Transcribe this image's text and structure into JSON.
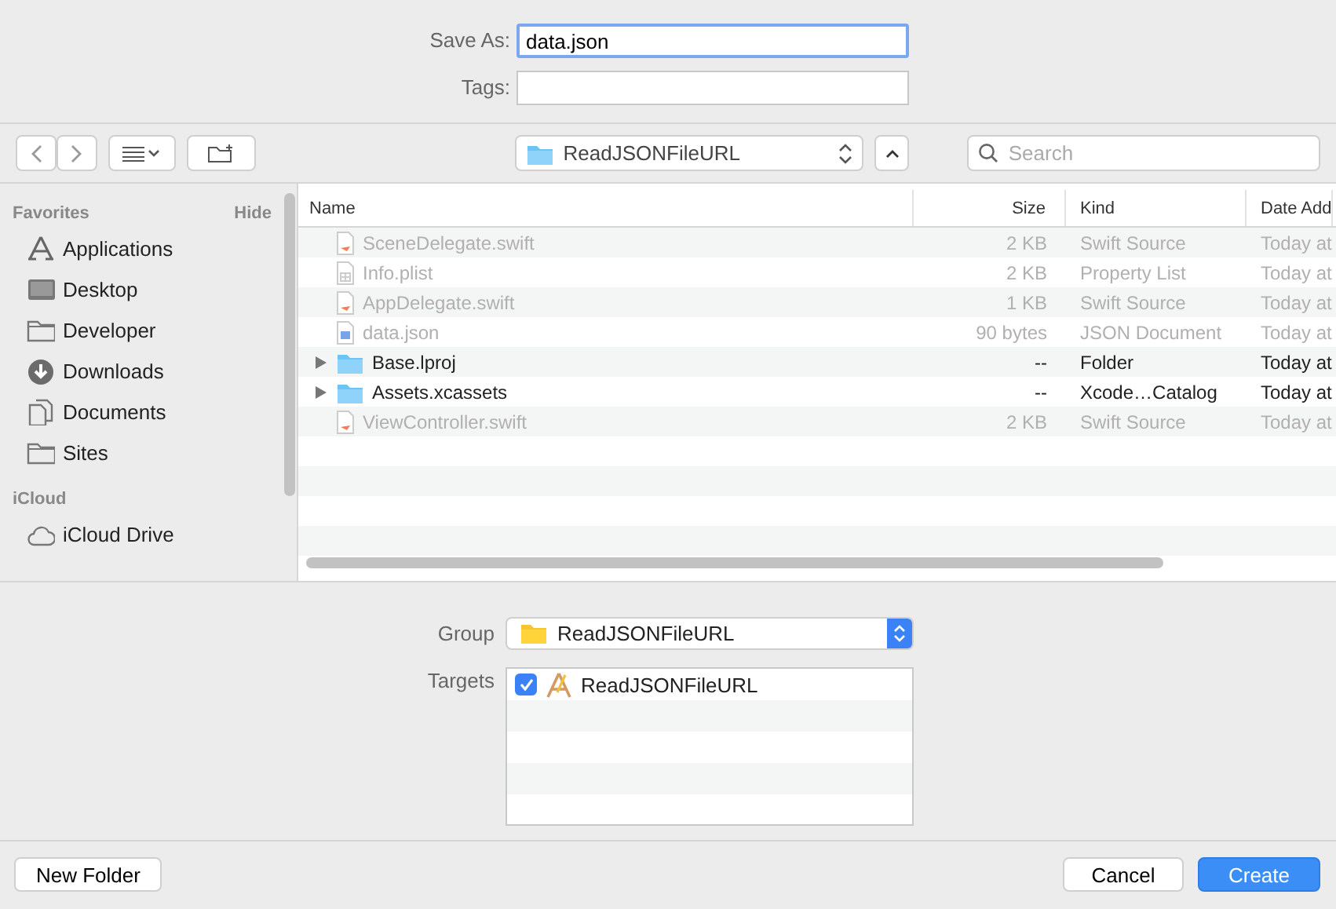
{
  "save_as": {
    "label": "Save As:",
    "value": "data.json"
  },
  "tags": {
    "label": "Tags:"
  },
  "toolbar": {
    "path": "ReadJSONFileURL",
    "search_placeholder": "Search"
  },
  "sidebar": {
    "sections": [
      {
        "title": "Favorites",
        "action": "Hide",
        "items": [
          {
            "label": "Applications"
          },
          {
            "label": "Desktop"
          },
          {
            "label": "Developer"
          },
          {
            "label": "Downloads"
          },
          {
            "label": "Documents"
          },
          {
            "label": "Sites"
          }
        ]
      },
      {
        "title": "iCloud",
        "items": [
          {
            "label": "iCloud Drive"
          }
        ]
      }
    ]
  },
  "table": {
    "columns": [
      "Name",
      "Size",
      "Kind",
      "Date Add"
    ],
    "rows": [
      {
        "kind": "swift",
        "disabled": true,
        "cells": [
          "SceneDelegate.swift",
          "2 KB",
          "Swift Source",
          "Today at"
        ]
      },
      {
        "kind": "plist",
        "disabled": true,
        "cells": [
          "Info.plist",
          "2 KB",
          "Property List",
          "Today at"
        ]
      },
      {
        "kind": "swift",
        "disabled": true,
        "cells": [
          "AppDelegate.swift",
          "1 KB",
          "Swift Source",
          "Today at"
        ]
      },
      {
        "kind": "json",
        "disabled": true,
        "cells": [
          "data.json",
          "90 bytes",
          "JSON Document",
          "Today at"
        ]
      },
      {
        "kind": "folder",
        "disabled": false,
        "cells": [
          "Base.lproj",
          "--",
          "Folder",
          "Today at"
        ]
      },
      {
        "kind": "folder",
        "disabled": false,
        "cells": [
          "Assets.xcassets",
          "--",
          "Xcode…Catalog",
          "Today at"
        ]
      },
      {
        "kind": "swift",
        "disabled": true,
        "cells": [
          "ViewController.swift",
          "2 KB",
          "Swift Source",
          "Today at"
        ]
      }
    ]
  },
  "group": {
    "label": "Group",
    "value": "ReadJSONFileURL"
  },
  "targets": {
    "label": "Targets",
    "items": [
      {
        "label": "ReadJSONFileURL",
        "checked": true
      }
    ]
  },
  "buttons": {
    "new_folder": "New Folder",
    "cancel": "Cancel",
    "create": "Create"
  }
}
